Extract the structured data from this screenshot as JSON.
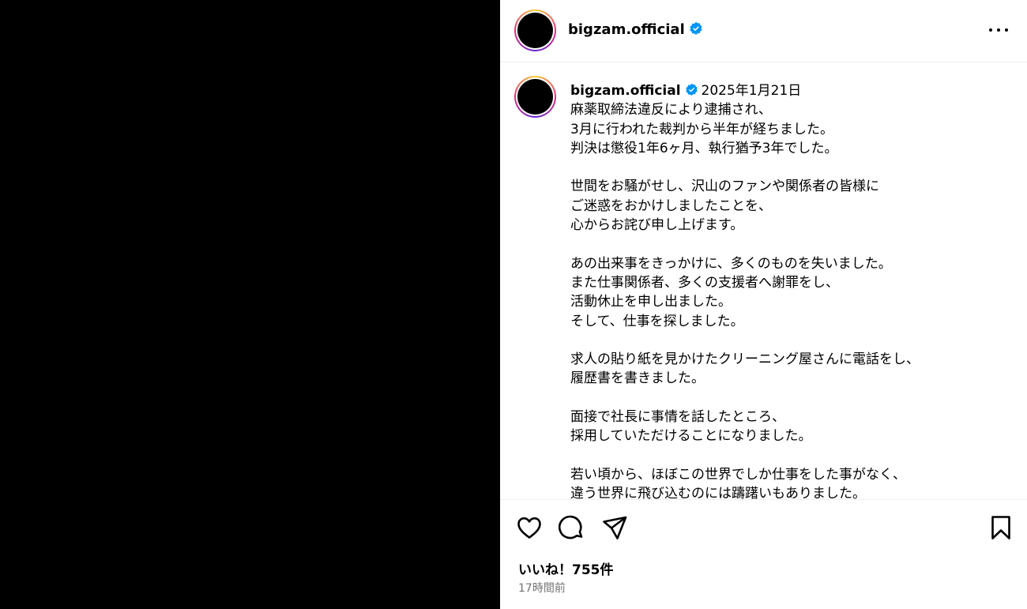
{
  "post": {
    "username": "bigzam.official",
    "verified": true,
    "date": "2025年1月21日",
    "caption_lines": [
      "麻薬取締法違反により逮捕され、",
      "3月に行われた裁判から半年が経ちました。",
      "判決は懲役1年6ヶ月、執行猶予3年でした。",
      "",
      "世間をお騒がせし、沢山のファンや関係者の皆様に",
      "ご迷惑をおかけしましたことを、",
      "心からお詫び申し上げます。",
      "",
      "あの出来事をきっかけに、多くのものを失いました。",
      "また仕事関係者、多くの支援者へ謝罪をし、",
      "活動休止を申し出ました。",
      "そして、仕事を探しました。",
      "",
      "求人の貼り紙を見かけたクリーニング屋さんに電話をし、",
      "履歴書を書きました。",
      "",
      "面接で社長に事情を話したところ、",
      "採用していただけることになりました。",
      "",
      "若い頃から、ほぼこの世界でしか仕事をした事がなく、",
      "違う世界に飛び込むのには躊躇いもありました。"
    ],
    "likes_text": "いいね！755件",
    "time_ago": "17時間前"
  },
  "icons": {
    "more": "more-horizontal-icon",
    "verified": "verified-badge-icon",
    "like": "heart-icon",
    "comment": "comment-icon",
    "share": "send-icon",
    "save": "bookmark-icon"
  },
  "colors": {
    "verified_blue": "#0095f6",
    "media_background": "#000000",
    "secondary_text": "#737373"
  }
}
